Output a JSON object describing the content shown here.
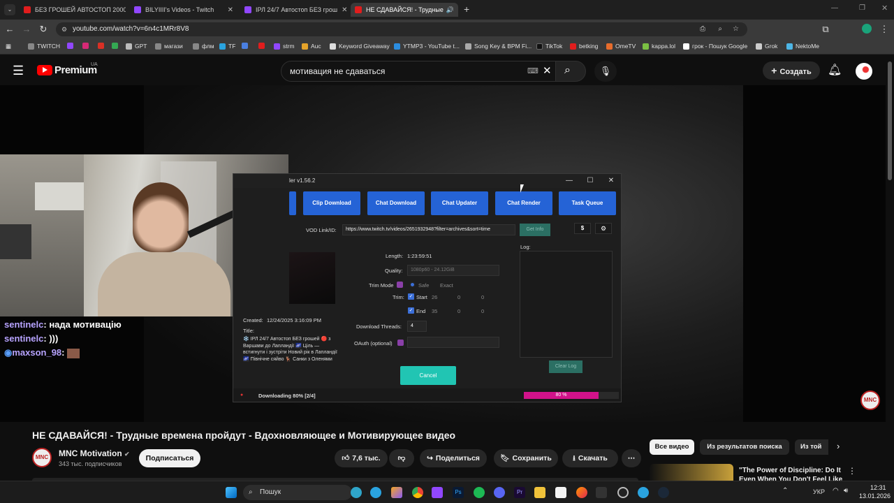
{
  "browser": {
    "tabs": [
      {
        "label": "БЕЗ ГРОШЕЙ АВТОСТОП 2000",
        "color": "#e11d1d",
        "active": false
      },
      {
        "label": "BILYIIII's Videos - Twitch",
        "color": "#9147ff",
        "active": false
      },
      {
        "label": "ІРЛ 24/7 Автостоп БЕЗ грош",
        "color": "#9147ff",
        "active": false
      },
      {
        "label": "НЕ СДАВАЙСЯ! - Трудные",
        "color": "#e11d1d",
        "active": true
      }
    ],
    "url": "youtube.com/watch?v=6n4c1MRr8V8",
    "bookmarks": [
      "TWITCH",
      "",
      "",
      "",
      "",
      "GPT",
      "магази",
      "флм",
      "TF",
      "",
      "",
      "strm",
      "Auc",
      "Keyword Giveaway",
      "YTMP3 - YouTube t...",
      "Song Key & BPM Fi...",
      "TikTok",
      "betking",
      "OmeTV",
      "kappa.lol",
      "грок - Пошук Google",
      "Grok",
      "NektoMe"
    ]
  },
  "youtube": {
    "logo_label": "Premium",
    "region": "UA",
    "search_value": "мотивация не сдаваться",
    "create_label": "Создать",
    "video_title": "НЕ СДАВАЙСЯ! - Трудные времена пройдут - Вдохновляющее и Мотивирующее видео",
    "channel_name": "MNC Motivation",
    "subscribers": "343 тыс. подписчиков",
    "subscribe_label": "Подписаться",
    "likes": "7,6 тыс.",
    "share_label": "Поделиться",
    "save_label": "Сохранить",
    "download_label": "Скачать",
    "filter_chips": [
      "Все видео",
      "Из результатов поиска",
      "Из той"
    ],
    "rec_title_line1": "\"The Power of Discipline: Do It",
    "rec_title_line2": "Even When You Don't Feel Like"
  },
  "stream_chat": [
    {
      "user": "sentinelc",
      "text": "нада мотивацію"
    },
    {
      "user": "sentinelc",
      "text": ")))"
    },
    {
      "user": "maxson_98",
      "text": ""
    }
  ],
  "downloader": {
    "title": "ler v1.56.2",
    "tabs": [
      "Clip Download",
      "Chat Download",
      "Chat Updater",
      "Chat Render",
      "Task Queue"
    ],
    "vod_label": "VOD Link/ID:",
    "vod_value": "https://www.twitch.tv/videos/2651932948?filter=archives&sort=time",
    "get_info": "Get Info",
    "dollar": "$",
    "length_label": "Length:",
    "length_value": "1:23:59:51",
    "quality_label": "Quality:",
    "quality_value": "1080p60 - 24.12GiB",
    "trim_mode_label": "Trim Mode",
    "trim_safe": "Safe",
    "trim_exact": "Exact",
    "trim_label": "Trim:",
    "start_label": "Start",
    "start_values": [
      "26",
      "0",
      "0"
    ],
    "end_label": "End",
    "end_values": [
      "35",
      "0",
      "0"
    ],
    "threads_label": "Download Threads:",
    "threads_value": "4",
    "oauth_label": "OAuth (optional)",
    "created_label": "Created:",
    "created_value": "12/24/2025 3:16:09 PM",
    "title_label": "Title:",
    "title_value": "❄️ ІРЛ 24/7 Автостоп БЕЗ грошей 🔴 з Варшави до Лапландії 🌌 Ціль — встигнути і зустріти Новий рік в Лапландії 🌌 Північне сяйво 🦌 Санки з Оленями",
    "log_label": "Log:",
    "clear_log": "Clear Log",
    "cancel": "Cancel",
    "status": "Downloading 80% [2/4]",
    "progress_text": "80 %",
    "progress": 0.8
  },
  "taskbar": {
    "search_label": "Пошук",
    "lang": "УКР",
    "time": "12:31",
    "date": "13.01.2026"
  }
}
